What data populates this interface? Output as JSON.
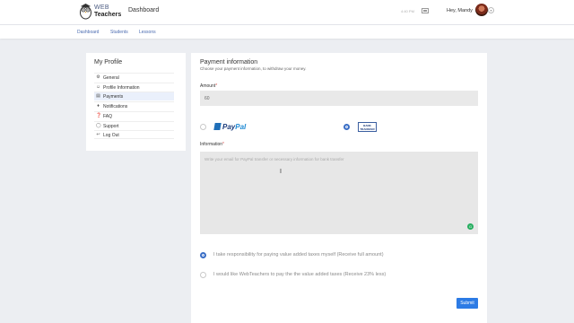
{
  "header": {
    "logo_web": "WEB",
    "logo_teachers": "Teachers",
    "title": "Dashboard",
    "time": "4:40 PM",
    "greeting": "Hey, Mandy"
  },
  "subnav": {
    "items": [
      {
        "label": "Dashboard"
      },
      {
        "label": "Students"
      },
      {
        "label": "Lessons"
      }
    ]
  },
  "sidebar": {
    "title": "My Profile",
    "items": [
      {
        "label": "General",
        "icon": "gear-icon"
      },
      {
        "label": "Profile Information",
        "icon": "user-icon"
      },
      {
        "label": "Payments",
        "icon": "card-icon",
        "active": true
      },
      {
        "label": "Notifications",
        "icon": "bell-icon"
      },
      {
        "label": "FAQ",
        "icon": "question-icon"
      },
      {
        "label": "Support",
        "icon": "support-icon"
      },
      {
        "label": "Log Out",
        "icon": "logout-icon"
      }
    ]
  },
  "payment": {
    "title": "Payment information",
    "subtitle": "Choose your payment information, to withdraw your money.",
    "amount_label": "Amount",
    "amount_value": "60",
    "required_mark": "*",
    "methods": [
      {
        "name": "PayPal",
        "name_part1": "Pay",
        "name_part2": "Pal",
        "selected": false
      },
      {
        "name": "Bank Transfer",
        "logo_text": "BANK TRANSFER",
        "selected": true
      }
    ],
    "info_label": "Information",
    "info_placeholder": "Write your email for PayPal transfer or necessary information for bank transfer",
    "tax_options": [
      {
        "label": "I take responsibility for paying value added taxes myself (Receive full amount)",
        "selected": true
      },
      {
        "label": "I would like WebTeachers to pay the the value added taxes (Receive 23% less)",
        "selected": false
      }
    ],
    "submit_label": "Submit"
  },
  "colors": {
    "accent": "#2c7be5",
    "radio_selected": "#3b6fc6",
    "background": "#eceef2"
  }
}
